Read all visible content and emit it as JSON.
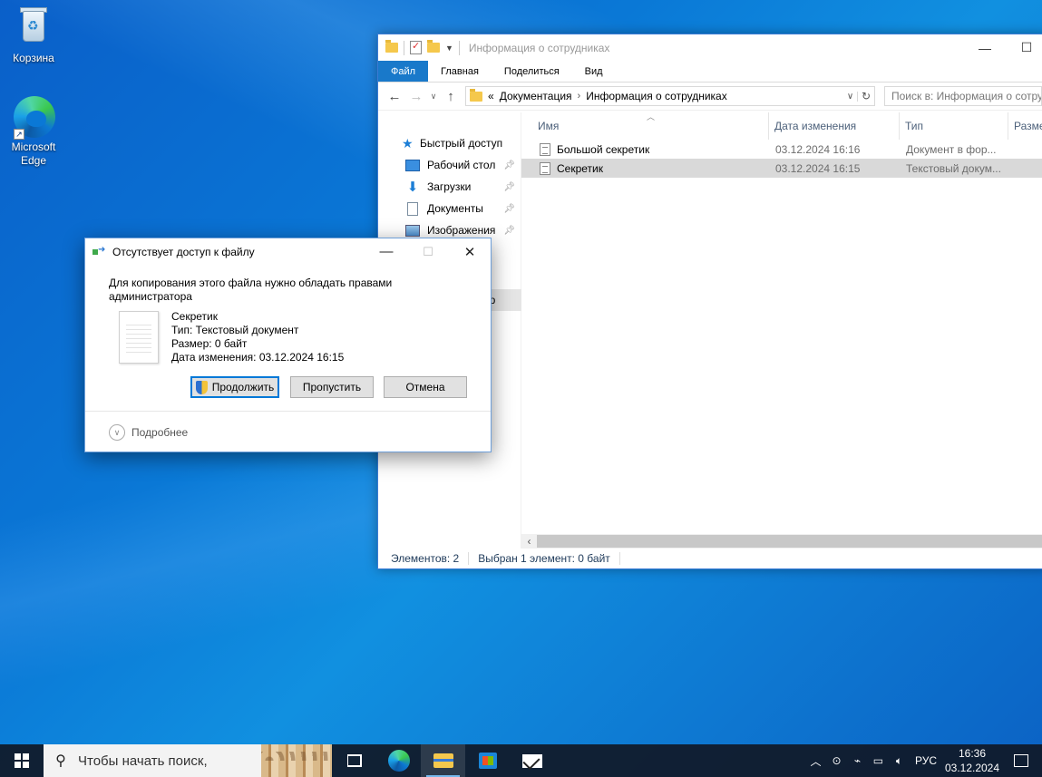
{
  "desktop": {
    "icons": [
      {
        "label": "Корзина",
        "icon": "recycle-bin-icon"
      },
      {
        "label": "Microsoft Edge",
        "icon": "edge-icon"
      }
    ]
  },
  "explorer": {
    "title": "Информация о сотрудниках",
    "tabs": [
      "Файл",
      "Главная",
      "Поделиться",
      "Вид"
    ],
    "address": {
      "prefix": "«",
      "path": [
        "Документация",
        "Информация о сотрудниках"
      ]
    },
    "search_placeholder": "Поиск в: Информация о сотрудниках",
    "nav": [
      {
        "label": "Быстрый доступ",
        "icon": "star-icon",
        "pinned": false
      },
      {
        "label": "Рабочий стол",
        "icon": "desktop-folder-icon",
        "pinned": true
      },
      {
        "label": "Загрузки",
        "icon": "download-icon",
        "pinned": true
      },
      {
        "label": "Документы",
        "icon": "documents-icon",
        "pinned": true
      },
      {
        "label": "Изображения",
        "icon": "pictures-icon",
        "pinned": true
      }
    ],
    "nav_partial": "ер",
    "columns": {
      "name": "Имя",
      "date": "Дата изменения",
      "type": "Тип",
      "size": "Разме"
    },
    "files": [
      {
        "name": "Большой секретик",
        "date": "03.12.2024 16:16",
        "type": "Документ в фор...",
        "selected": false
      },
      {
        "name": "Секретик",
        "date": "03.12.2024 16:15",
        "type": "Текстовый докум...",
        "selected": true
      }
    ],
    "status": {
      "count": "Элементов: 2",
      "selection": "Выбран 1 элемент: 0 байт"
    }
  },
  "dialog": {
    "title": "Отсутствует доступ к файлу",
    "message": "Для копирования этого файла нужно обладать правами администратора",
    "file": {
      "name": "Секретик",
      "type": "Тип: Текстовый документ",
      "size": "Размер: 0 байт",
      "modified": "Дата изменения: 03.12.2024 16:15"
    },
    "buttons": {
      "continue": "Продолжить",
      "skip": "Пропустить",
      "cancel": "Отмена"
    },
    "details": "Подробнее"
  },
  "taskbar": {
    "search_placeholder": "Чтобы начать поиск,",
    "language": "РУС",
    "time": "16:36",
    "date": "03.12.2024"
  },
  "colors": {
    "accent": "#1979ca",
    "selection": "#d9d9d9"
  }
}
